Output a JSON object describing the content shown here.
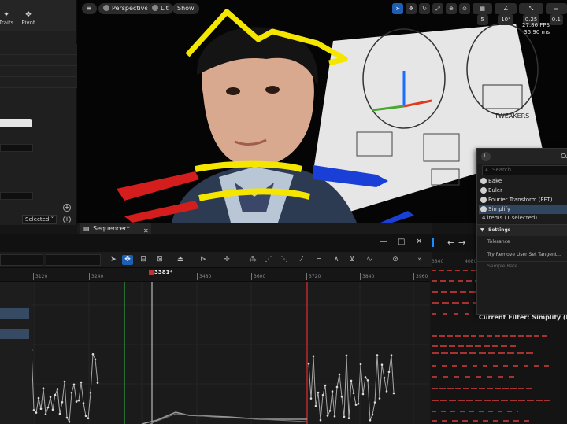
{
  "left_panel": {
    "tools": [
      {
        "label": "Traits",
        "icon": "traits-icon"
      },
      {
        "label": "Pivot",
        "icon": "pivot-icon"
      }
    ],
    "selected_dropdown": "Selected"
  },
  "viewport": {
    "perspective_label": "Perspective",
    "lit_label": "Lit",
    "show_label": "Show",
    "snap_count": "5",
    "angle": "10°",
    "scale": "0.25",
    "camera_speed": "0.1",
    "fps": "27.86 FPS",
    "ms": "35.90 ms",
    "sheet_label": "TWEAKERS"
  },
  "sequencer": {
    "tab_label": "Sequencer*",
    "window_controls": [
      "—",
      "□",
      "✕"
    ],
    "cursor_frame": "3381*",
    "ruler_ticks": [
      "3120",
      "3240",
      "3480",
      "3600",
      "3720",
      "3840",
      "3960"
    ],
    "right_ticks": [
      "3840",
      "4080"
    ]
  },
  "filter_popup": {
    "title": "Cu",
    "search_placeholder": "Search",
    "items": [
      {
        "label": "Bake",
        "selected": false
      },
      {
        "label": "Euler",
        "selected": false
      },
      {
        "label": "Fourier Transform (FFT)",
        "selected": false
      },
      {
        "label": "Simplify",
        "selected": true
      }
    ],
    "count_text": "4 items (1 selected)",
    "settings_label": "Settings",
    "properties": [
      {
        "label": "Tolerance",
        "enabled": true
      },
      {
        "label": "Try Remove User Set Tangent...",
        "enabled": true
      },
      {
        "label": "Sample Rate",
        "enabled": false
      }
    ],
    "current_filter": "Current Filter: Simplify (No Ke"
  },
  "colors": {
    "accent": "#1d5fb5",
    "selected_row": "#2f4560",
    "timeline_red": "#c0262b",
    "timeline_green": "#2e8b3a"
  }
}
